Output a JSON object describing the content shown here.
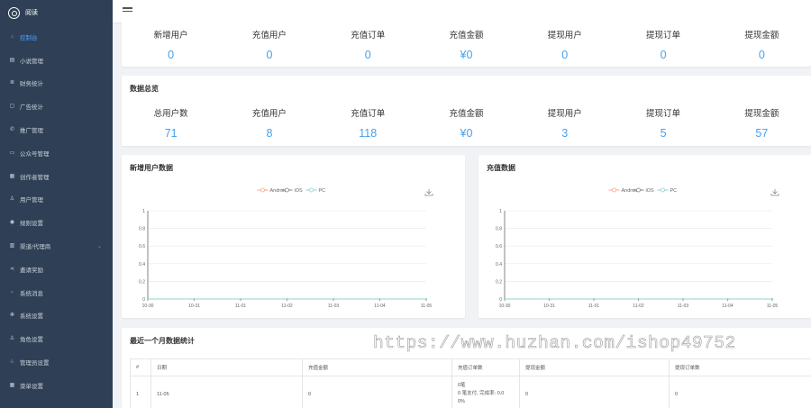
{
  "app": {
    "logo_text": "阅读"
  },
  "sidebar": {
    "items": [
      {
        "label": "控制台",
        "icon": "home-icon",
        "active": true
      },
      {
        "label": "小说管理",
        "icon": "book-icon"
      },
      {
        "label": "财务统计",
        "icon": "list-icon"
      },
      {
        "label": "广告统计",
        "icon": "ad-icon"
      },
      {
        "label": "推广管理",
        "icon": "phone-icon"
      },
      {
        "label": "公众号管理",
        "icon": "window-icon"
      },
      {
        "label": "创作者管理",
        "icon": "grid-icon"
      },
      {
        "label": "用户管理",
        "icon": "user-icon"
      },
      {
        "label": "规则设置",
        "icon": "location-icon"
      },
      {
        "label": "渠道/代理商",
        "icon": "channel-icon",
        "expandable": true
      },
      {
        "label": "邀请奖励",
        "icon": "share-icon"
      },
      {
        "label": "系统消息",
        "icon": "message-icon"
      },
      {
        "label": "系统设置",
        "icon": "gear-icon"
      },
      {
        "label": "角色设置",
        "icon": "role-icon"
      },
      {
        "label": "管理员设置",
        "icon": "admin-icon"
      },
      {
        "label": "菜单设置",
        "icon": "menu-grid-icon"
      }
    ]
  },
  "topbar": {
    "menu_icon": "hamburger-icon"
  },
  "today": {
    "stats": [
      {
        "label": "新增用户",
        "value": "0"
      },
      {
        "label": "充值用户",
        "value": "0"
      },
      {
        "label": "充值订单",
        "value": "0"
      },
      {
        "label": "充值金额",
        "value": "¥0"
      },
      {
        "label": "提现用户",
        "value": "0"
      },
      {
        "label": "提现订单",
        "value": "0"
      },
      {
        "label": "提现金额",
        "value": "0"
      }
    ]
  },
  "overview": {
    "title": "数据总览",
    "stats": [
      {
        "label": "总用户数",
        "value": "71"
      },
      {
        "label": "充值用户",
        "value": "8"
      },
      {
        "label": "充值订单",
        "value": "118"
      },
      {
        "label": "充值金额",
        "value": "¥0"
      },
      {
        "label": "提现用户",
        "value": "3"
      },
      {
        "label": "提现订单",
        "value": "5"
      },
      {
        "label": "提现金额",
        "value": "57"
      }
    ]
  },
  "charts_panels": {
    "new_users_title": "新增用户数据",
    "recharge_title": "充值数据",
    "download_icon": "download-icon"
  },
  "chart_data": [
    {
      "type": "line",
      "title": "新增用户数据",
      "x": [
        "10-30",
        "10-31",
        "11-01",
        "11-02",
        "11-03",
        "11-04",
        "11-05"
      ],
      "series": [
        {
          "name": "Android",
          "values": [
            0,
            0,
            0,
            0,
            0,
            0,
            0
          ],
          "color": "#f3a98d"
        },
        {
          "name": "iOS",
          "values": [
            0,
            0,
            0,
            0,
            0,
            0,
            0
          ],
          "color": "#7a8a93"
        },
        {
          "name": "PC",
          "values": [
            0,
            0,
            0,
            0,
            0,
            0,
            0
          ],
          "color": "#8fd3d0"
        }
      ],
      "yticks": [
        "0",
        "0.2",
        "0.4",
        "0.6",
        "0.8",
        "1"
      ],
      "ylim": [
        0,
        1
      ],
      "grid": true,
      "legend": "top-center"
    },
    {
      "type": "line",
      "title": "充值数据",
      "x": [
        "10-30",
        "10-31",
        "11-01",
        "11-02",
        "11-03",
        "11-04",
        "11-05"
      ],
      "series": [
        {
          "name": "Android",
          "values": [
            0,
            0,
            0,
            0,
            0,
            0,
            0
          ],
          "color": "#f3a98d"
        },
        {
          "name": "iOS",
          "values": [
            0,
            0,
            0,
            0,
            0,
            0,
            0
          ],
          "color": "#7a8a93"
        },
        {
          "name": "PC",
          "values": [
            0,
            0,
            0,
            0,
            0,
            0,
            0
          ],
          "color": "#8fd3d0"
        }
      ],
      "yticks": [
        "0",
        "0.2",
        "0.4",
        "0.6",
        "0.8",
        "1"
      ],
      "ylim": [
        0,
        1
      ],
      "grid": true,
      "legend": "top-center"
    }
  ],
  "monthly": {
    "title": "最近一个月数据统计",
    "headers": [
      "#",
      "日期",
      "充值金额",
      "充值订单数",
      "提现金额",
      "提现订单数"
    ],
    "rows": [
      {
        "index": "1",
        "date": "11-05",
        "amount": "0",
        "orders_lines": [
          "0笔",
          "0 笔支付, 完成率: 0.0",
          "0%"
        ],
        "withdraw_amount": "0",
        "withdraw_orders": "0"
      }
    ]
  },
  "watermark": "https://www.huzhan.com/ishop49752",
  "colors": {
    "sidebar_bg": "#2f4056",
    "accent": "#45a1ee",
    "active_nav": "#4fa3ff"
  }
}
